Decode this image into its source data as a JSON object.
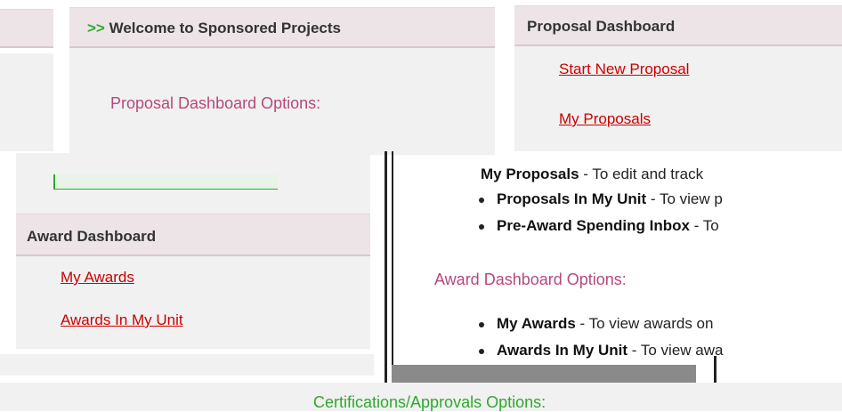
{
  "welcome": {
    "arrow": ">>",
    "title": "Welcome to Sponsored Projects"
  },
  "proposal_options_heading": "Proposal Dashboard Options:",
  "proposal_dashboard": {
    "title": "Proposal Dashboard",
    "links": [
      "Start New Proposal",
      "My Proposals"
    ]
  },
  "proposal_options": [
    {
      "name": "My Proposals",
      "desc": "- To edit and track"
    },
    {
      "name": "Proposals In My Unit",
      "desc": "- To view p"
    },
    {
      "name": "Pre-Award Spending Inbox",
      "desc": "- To"
    }
  ],
  "award_dashboard": {
    "title": "Award Dashboard",
    "links": [
      "My Awards",
      "Awards In My Unit"
    ]
  },
  "award_options_heading": "Award Dashboard Options:",
  "award_options": [
    {
      "name": "My Awards",
      "desc": "- To view awards on"
    },
    {
      "name": "Awards In My Unit",
      "desc": "- To view awa"
    }
  ],
  "certifications_heading": "Certifications/Approvals Options:",
  "colors": {
    "link": "#cc0000",
    "section": "#b44a7a",
    "arrow": "#2eaa2e",
    "header_bg": "#ece4e6"
  }
}
